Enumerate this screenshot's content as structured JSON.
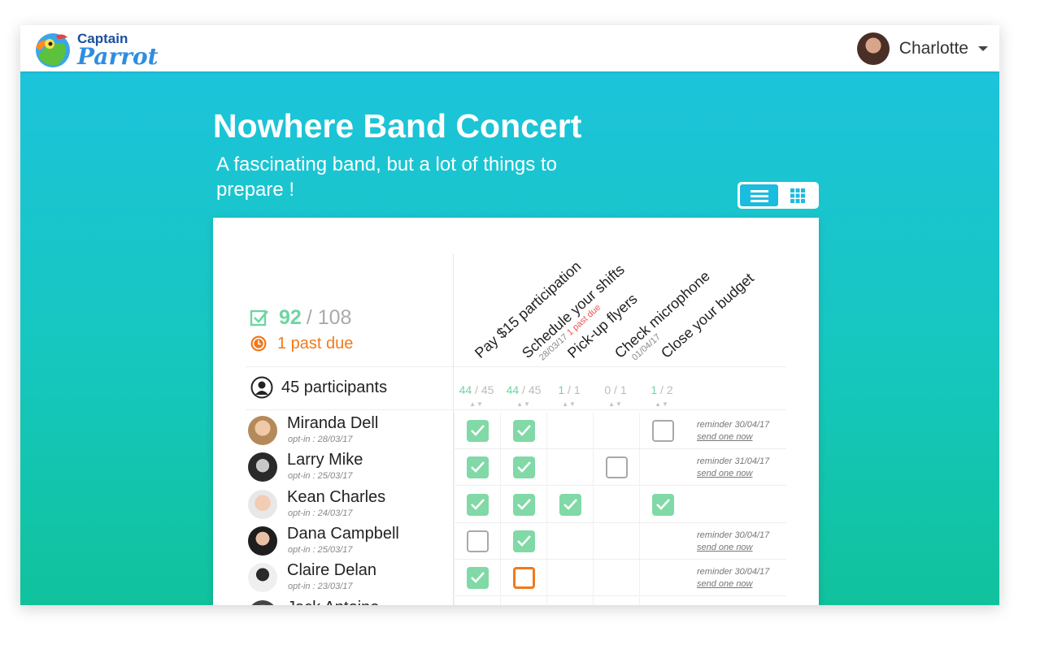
{
  "app": {
    "logo_top": "Captain",
    "logo_bottom": "Parrot",
    "user_name": "Charlotte"
  },
  "event": {
    "title": "Nowhere Band Concert",
    "subtitle": "A fascinating band, but a lot of things to prepare !"
  },
  "stats": {
    "done": "92",
    "total": "/ 108",
    "past_due": "1 past due",
    "participants": "45 participants"
  },
  "tasks": [
    {
      "label": "Pay $15 participation",
      "date": "",
      "due": "",
      "done": "44",
      "total": " / 45"
    },
    {
      "label": "Schedule your shifts",
      "date": "28/03/17",
      "due": "1 past due",
      "done": "44",
      "total": " / 45"
    },
    {
      "label": "Pick-up flyers",
      "date": "",
      "due": "",
      "done": "1",
      "total": " / 1"
    },
    {
      "label": "Check microphone",
      "date": "01/04/17",
      "due": "",
      "done": "0",
      "total": " / 1"
    },
    {
      "label": "Close your budget",
      "date": "",
      "due": "",
      "done": "1",
      "total": " / 2"
    }
  ],
  "people": [
    {
      "name": "Miranda Dell",
      "optin": "opt-in : 28/03/17",
      "cells": [
        "checked",
        "checked",
        "none",
        "none",
        "empty"
      ],
      "reminder": "reminder 30/04/17",
      "send": "send one now"
    },
    {
      "name": "Larry Mike",
      "optin": "opt-in : 25/03/17",
      "cells": [
        "checked",
        "checked",
        "none",
        "empty",
        "none"
      ],
      "reminder": "reminder 31/04/17",
      "send": "send one now"
    },
    {
      "name": "Kean Charles",
      "optin": "opt-in : 24/03/17",
      "cells": [
        "checked",
        "checked",
        "checked",
        "none",
        "checked"
      ],
      "reminder": "",
      "send": ""
    },
    {
      "name": "Dana Campbell",
      "optin": "opt-in : 25/03/17",
      "cells": [
        "empty",
        "checked",
        "none",
        "none",
        "none"
      ],
      "reminder": "reminder 30/04/17",
      "send": "send one now"
    },
    {
      "name": "Claire Delan",
      "optin": "opt-in : 23/03/17",
      "cells": [
        "checked",
        "overdue",
        "none",
        "none",
        "none"
      ],
      "reminder": "reminder 30/04/17",
      "send": "send one now"
    },
    {
      "name": "Jack Antoine",
      "optin": "",
      "cells": [
        "none",
        "none",
        "none",
        "none",
        "none"
      ],
      "reminder": "",
      "send": ""
    }
  ],
  "colors": {
    "accent": "#1abcdf",
    "done_green": "#80d9a6",
    "overdue_orange": "#f07a1c",
    "past_due_red": "#ef5350"
  },
  "icons": {
    "list_view": "list-view-icon",
    "grid_view": "grid-view-icon",
    "check": "checkbox-icon",
    "clock": "clock-icon",
    "person": "person-icon",
    "dropdown": "chevron-down-icon"
  }
}
